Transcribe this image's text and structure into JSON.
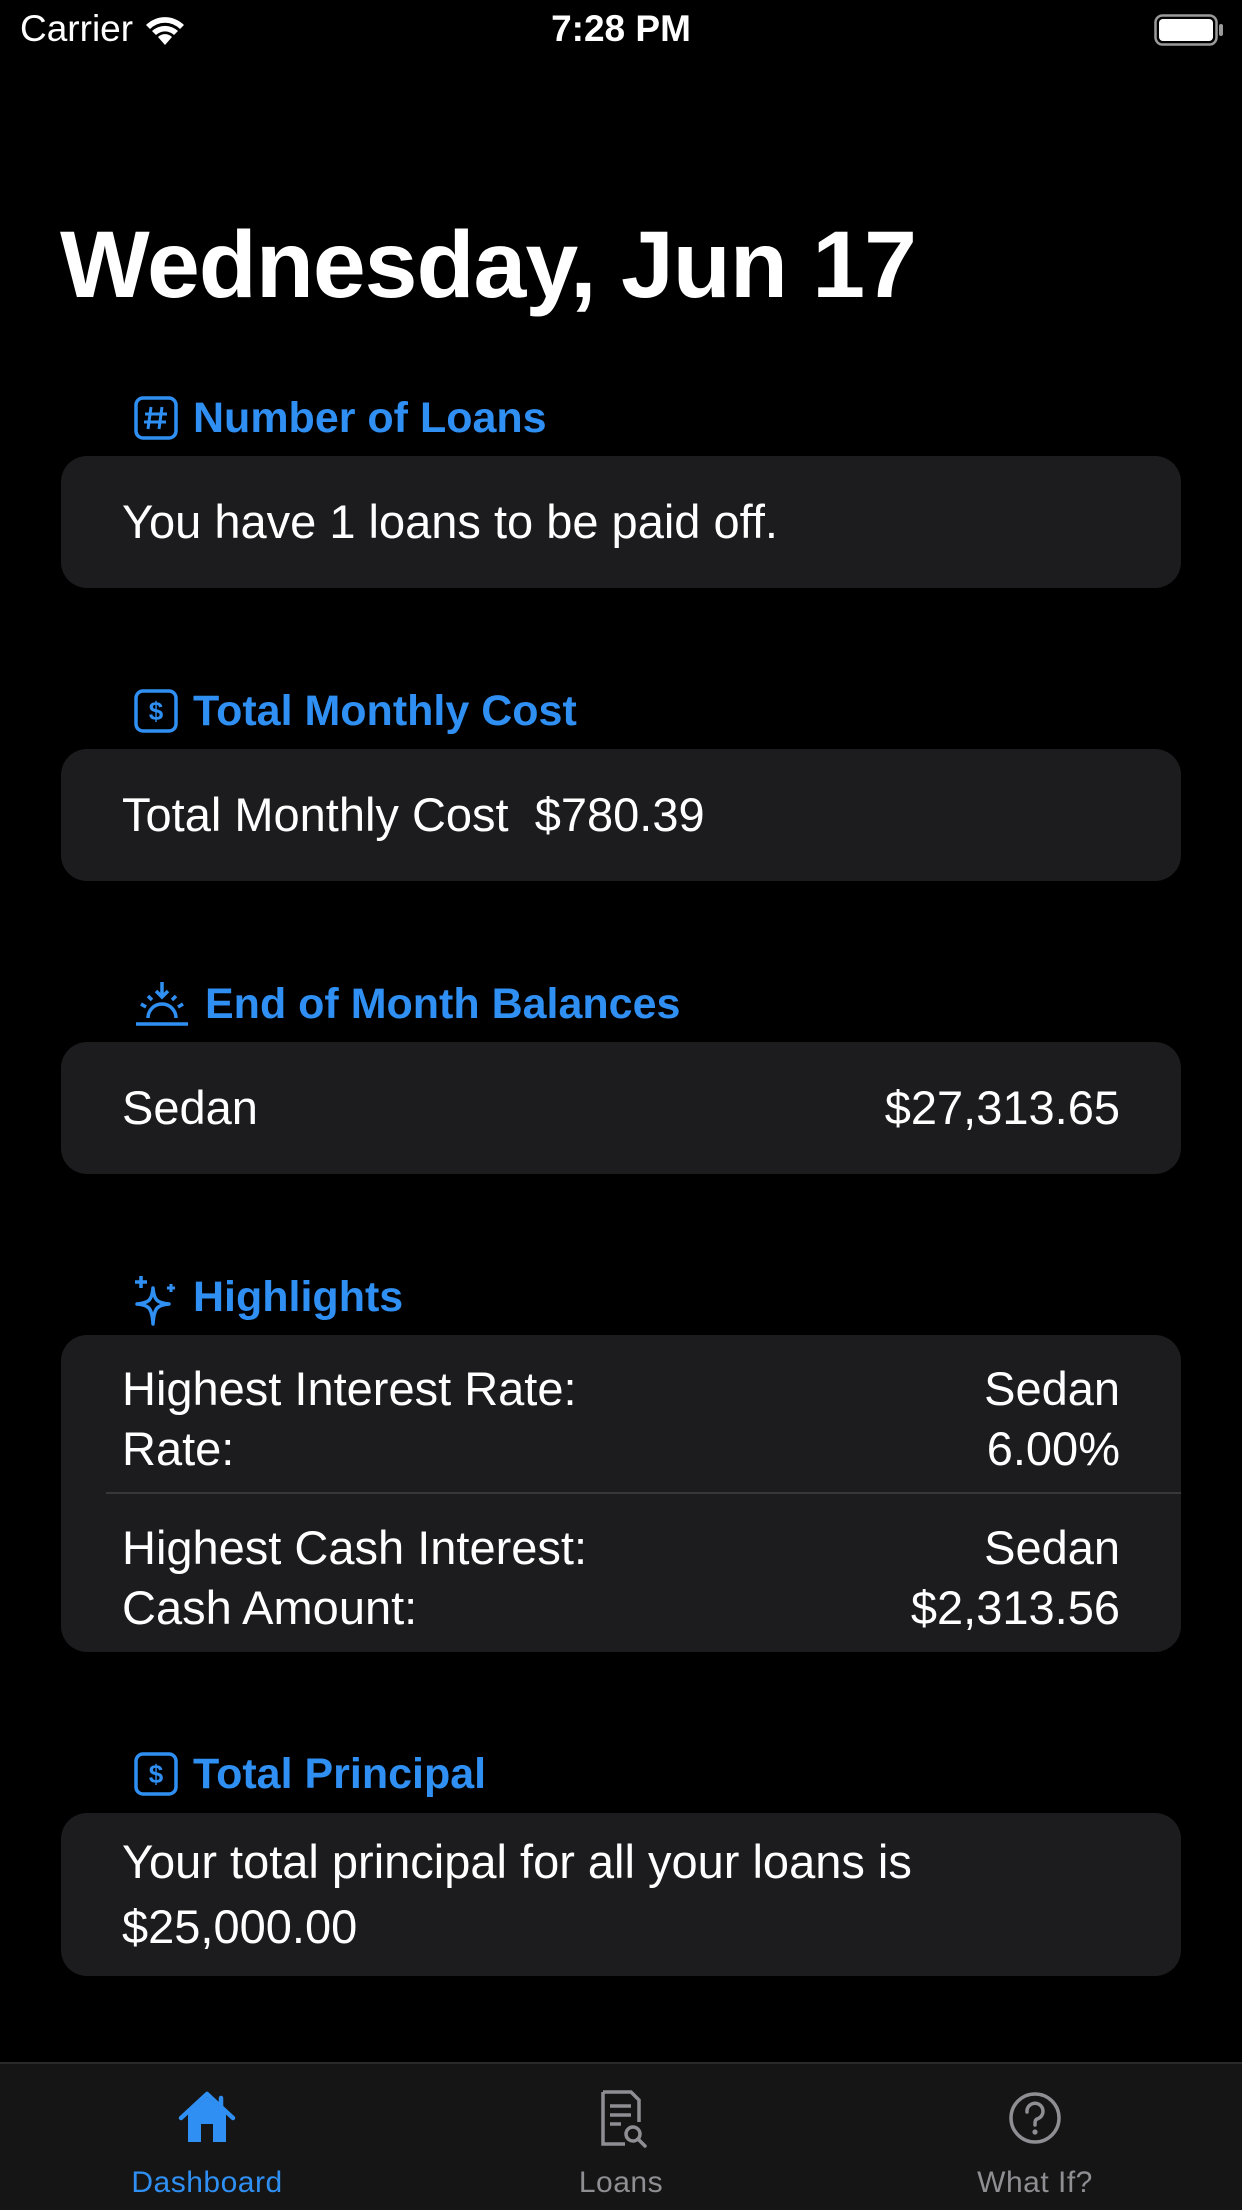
{
  "status_bar": {
    "carrier": "Carrier",
    "time": "7:28 PM"
  },
  "page_title": "Wednesday, Jun 17",
  "accent_color": "#2f8ff2",
  "sections": {
    "number_of_loans": {
      "icon": "number-sign-square-icon",
      "title": "Number of Loans",
      "text": "You have 1 loans to be paid off."
    },
    "total_monthly_cost": {
      "icon": "dollar-sign-square-icon",
      "title": "Total Monthly Cost",
      "label": "Total Monthly Cost",
      "value": "$780.39"
    },
    "end_of_month_balances": {
      "icon": "sunrise-icon",
      "title": "End of Month Balances",
      "items": [
        {
          "name": "Sedan",
          "value": "$27,313.65"
        }
      ]
    },
    "highlights": {
      "icon": "sparkles-icon",
      "title": "Highlights",
      "interest_rate": {
        "label": "Highest Interest Rate:",
        "name": "Sedan",
        "rate_label": "Rate:",
        "rate_value": "6.00%"
      },
      "cash_interest": {
        "label": "Highest Cash Interest:",
        "name": "Sedan",
        "amount_label": "Cash Amount:",
        "amount_value": "$2,313.56"
      }
    },
    "total_principal": {
      "icon": "dollar-sign-square-icon",
      "title": "Total Principal",
      "line1": "Your total principal for all your loans is",
      "line2": "$25,000.00"
    }
  },
  "tab_bar": {
    "tabs": [
      {
        "label": "Dashboard",
        "icon": "house-icon",
        "active": true
      },
      {
        "label": "Loans",
        "icon": "document-search-icon",
        "active": false
      },
      {
        "label": "What If?",
        "icon": "question-circle-icon",
        "active": false
      }
    ]
  }
}
